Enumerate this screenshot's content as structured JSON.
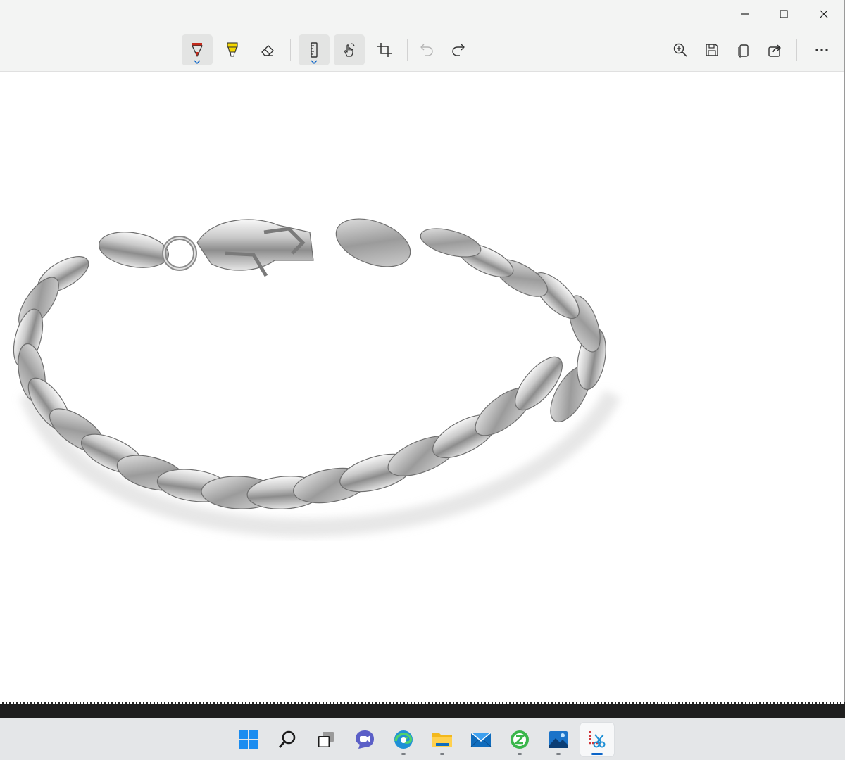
{
  "app": {
    "window_controls": [
      {
        "name": "minimize-button"
      },
      {
        "name": "maximize-button"
      },
      {
        "name": "close-button"
      }
    ]
  },
  "toolbar": {
    "tools": [
      {
        "name": "ballpoint-pen-tool",
        "icon": "ballpoint-pen-icon",
        "selected": true,
        "color": "#c42b1c"
      },
      {
        "name": "highlighter-tool",
        "icon": "highlighter-icon",
        "selected": false,
        "color": "#f4d700"
      },
      {
        "name": "eraser-tool",
        "icon": "eraser-icon",
        "selected": false
      },
      {
        "name": "ruler-tool",
        "icon": "ruler-icon",
        "selected": true
      },
      {
        "name": "touch-writing-tool",
        "icon": "touch-writing-icon",
        "selected": true
      },
      {
        "name": "crop-tool",
        "icon": "crop-icon",
        "selected": false
      },
      {
        "name": "undo-button",
        "icon": "undo-icon",
        "enabled": false
      },
      {
        "name": "redo-button",
        "icon": "redo-icon",
        "enabled": true
      }
    ],
    "actions": [
      {
        "name": "zoom-button",
        "icon": "zoom-in-icon"
      },
      {
        "name": "save-button",
        "icon": "save-icon"
      },
      {
        "name": "copy-button",
        "icon": "copy-icon"
      },
      {
        "name": "share-button",
        "icon": "share-icon"
      },
      {
        "name": "more-options-button",
        "icon": "more-icon"
      }
    ]
  },
  "canvas": {
    "content": "silver-chain-bracelet-image",
    "background": "#ffffff"
  },
  "taskbar": {
    "items": [
      {
        "name": "start-button",
        "icon": "windows-logo-icon",
        "running": false
      },
      {
        "name": "search-button",
        "icon": "search-icon",
        "running": false
      },
      {
        "name": "task-view-button",
        "icon": "task-view-icon",
        "running": false
      },
      {
        "name": "chat-button",
        "icon": "teams-chat-icon",
        "running": false
      },
      {
        "name": "edge-button",
        "icon": "edge-icon",
        "running": true
      },
      {
        "name": "file-explorer-button",
        "icon": "folder-icon",
        "running": true
      },
      {
        "name": "mail-button",
        "icon": "mail-icon",
        "running": false
      },
      {
        "name": "app-button",
        "icon": "green-app-icon",
        "running": true
      },
      {
        "name": "photos-button",
        "icon": "photos-icon",
        "running": true
      },
      {
        "name": "snipping-tool-button",
        "icon": "snipping-tool-icon",
        "running": true,
        "active": true
      }
    ],
    "accent": "#0a64c8"
  }
}
